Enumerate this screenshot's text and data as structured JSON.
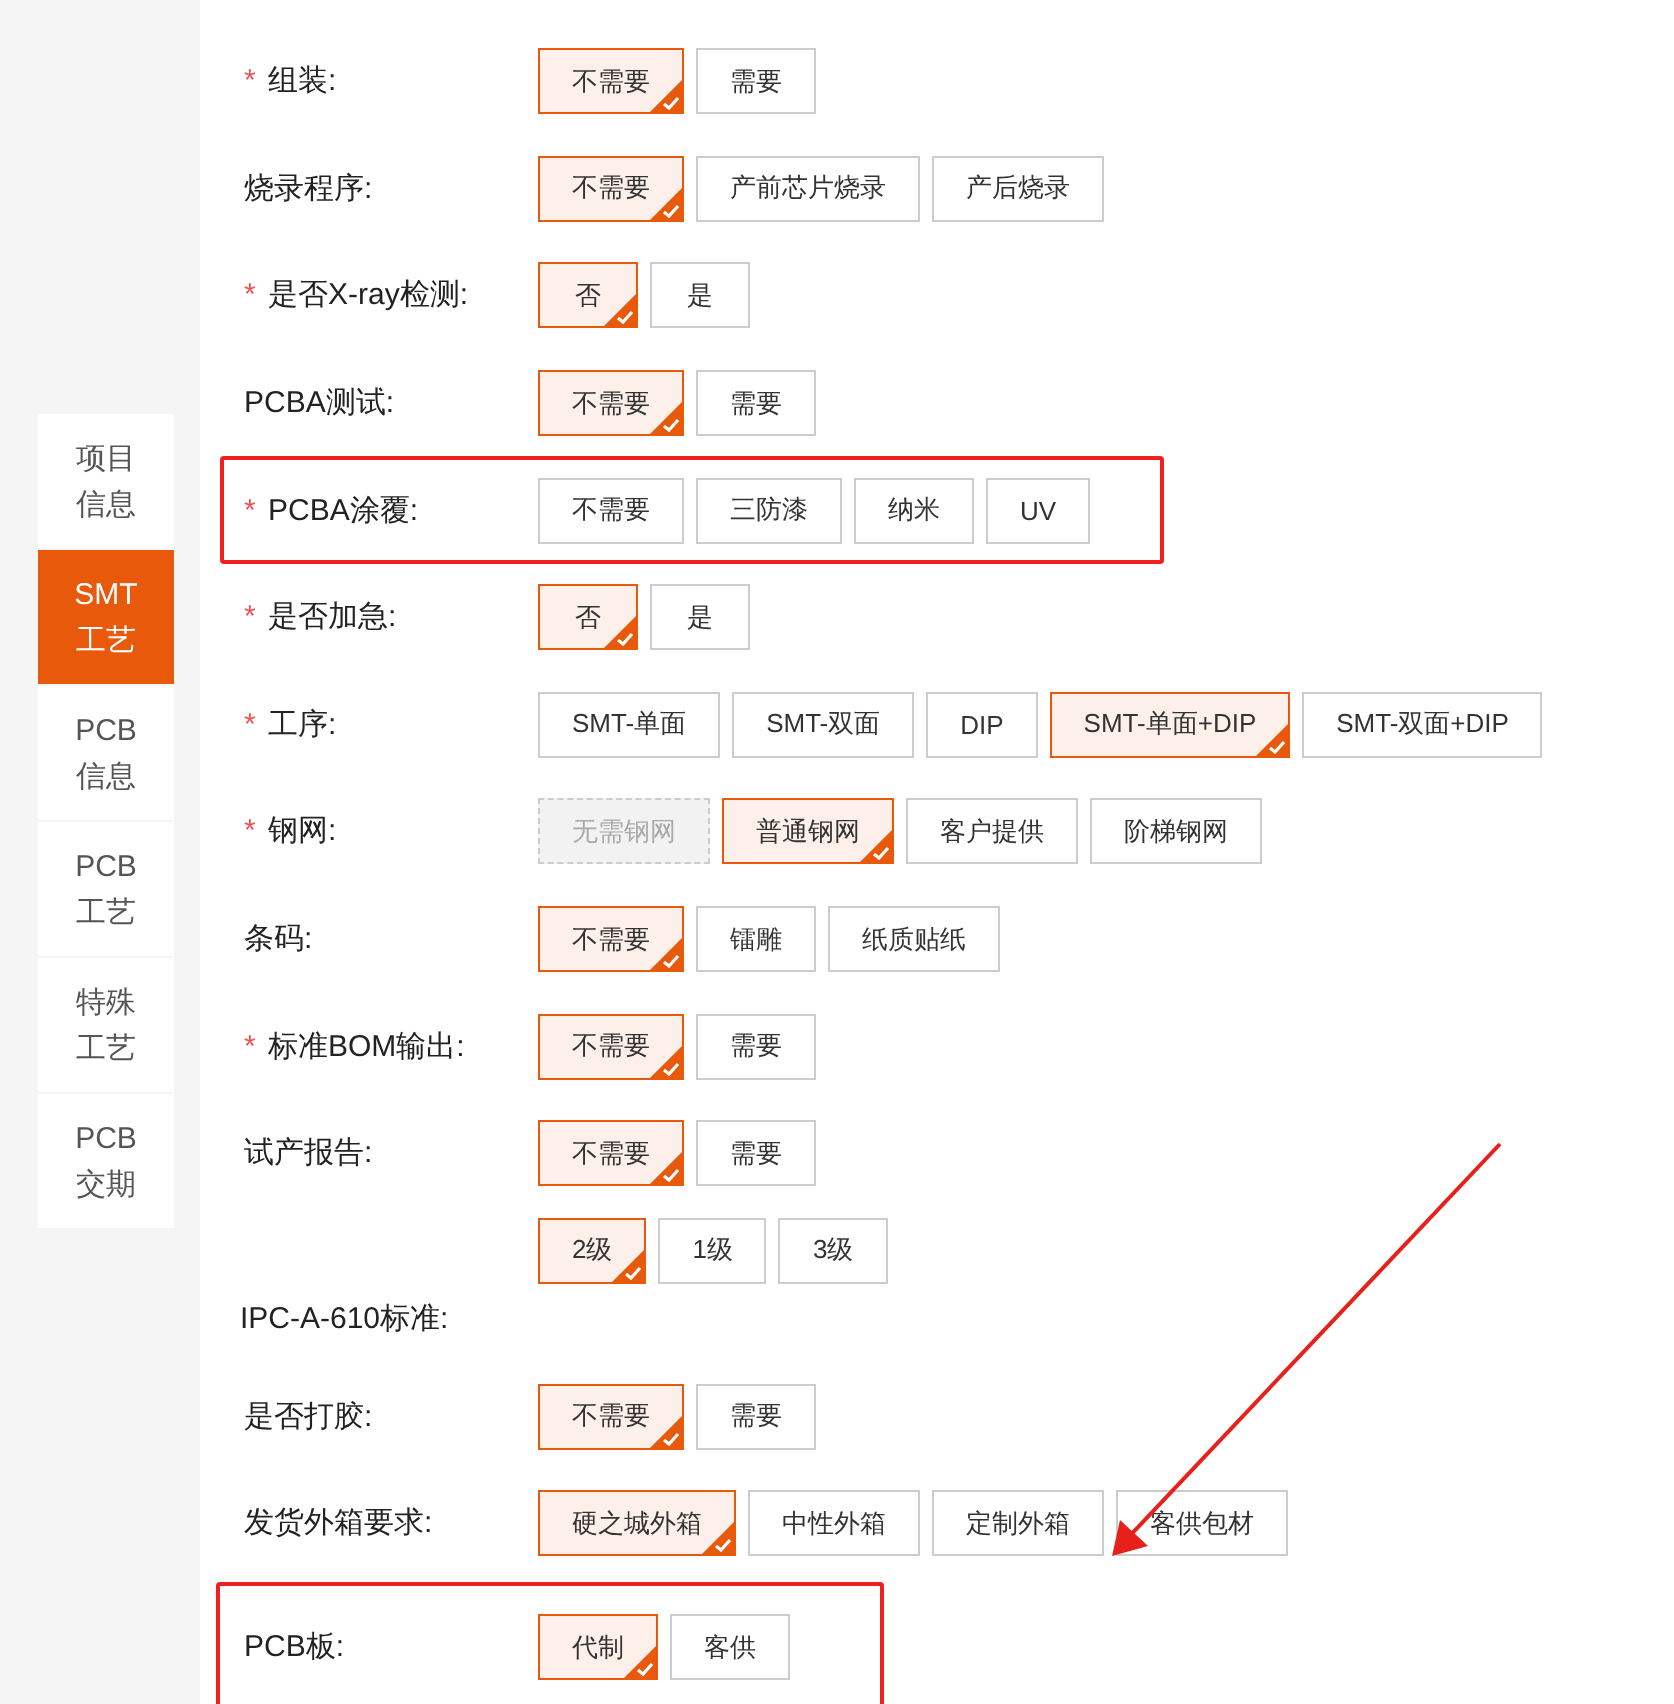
{
  "sidebar": {
    "items": [
      {
        "lines": [
          "项目",
          "信息"
        ],
        "selected": false
      },
      {
        "lines": [
          "SMT",
          "工艺"
        ],
        "selected": true
      },
      {
        "lines": [
          "PCB",
          "信息"
        ],
        "selected": false
      },
      {
        "lines": [
          "PCB",
          "工艺"
        ],
        "selected": false
      },
      {
        "lines": [
          "特殊",
          "工艺"
        ],
        "selected": false
      },
      {
        "lines": [
          "PCB",
          "交期"
        ],
        "selected": false
      }
    ]
  },
  "form": {
    "rows": [
      {
        "kind": "inline",
        "label": "组装:",
        "required_mark": "*",
        "highlighted": false,
        "options": [
          {
            "label": "不需要",
            "selected": true,
            "disabled": false
          },
          {
            "label": "需要",
            "selected": false,
            "disabled": false
          }
        ]
      },
      {
        "kind": "inline",
        "label": "烧录程序:",
        "highlighted": false,
        "options": [
          {
            "label": "不需要",
            "selected": true,
            "disabled": false
          },
          {
            "label": "产前芯片烧录",
            "selected": false,
            "disabled": false
          },
          {
            "label": "产后烧录",
            "selected": false,
            "disabled": false
          }
        ]
      },
      {
        "kind": "inline",
        "label": "是否X-ray检测:",
        "required_mark": "*",
        "highlighted": false,
        "options": [
          {
            "label": "否",
            "selected": true,
            "disabled": false
          },
          {
            "label": "是",
            "selected": false,
            "disabled": false
          }
        ]
      },
      {
        "kind": "inline",
        "label": "PCBA测试:",
        "highlighted": false,
        "options": [
          {
            "label": "不需要",
            "selected": true,
            "disabled": false
          },
          {
            "label": "需要",
            "selected": false,
            "disabled": false
          }
        ]
      },
      {
        "kind": "inline",
        "label": "PCBA涂覆:",
        "required_mark": "*",
        "highlighted": true,
        "options": [
          {
            "label": "不需要",
            "selected": false,
            "disabled": false
          },
          {
            "label": "三防漆",
            "selected": false,
            "disabled": false
          },
          {
            "label": "纳米",
            "selected": false,
            "disabled": false
          },
          {
            "label": "UV",
            "selected": false,
            "disabled": false
          }
        ]
      },
      {
        "kind": "inline",
        "label": "是否加急:",
        "required_mark": "*",
        "highlighted": false,
        "options": [
          {
            "label": "否",
            "selected": true,
            "disabled": false
          },
          {
            "label": "是",
            "selected": false,
            "disabled": false
          }
        ]
      },
      {
        "kind": "inline",
        "label": "工序:",
        "required_mark": "*",
        "highlighted": false,
        "options": [
          {
            "label": "SMT-单面",
            "selected": false,
            "disabled": false
          },
          {
            "label": "SMT-双面",
            "selected": false,
            "disabled": false
          },
          {
            "label": "DIP",
            "selected": false,
            "disabled": false
          },
          {
            "label": "SMT-单面+DIP",
            "selected": true,
            "disabled": false
          },
          {
            "label": "SMT-双面+DIP",
            "selected": false,
            "disabled": false
          }
        ]
      },
      {
        "kind": "inline",
        "label": "钢网:",
        "required_mark": "*",
        "highlighted": false,
        "options": [
          {
            "label": "无需钢网",
            "selected": false,
            "disabled": true
          },
          {
            "label": "普通钢网",
            "selected": true,
            "disabled": false
          },
          {
            "label": "客户提供",
            "selected": false,
            "disabled": false
          },
          {
            "label": "阶梯钢网",
            "selected": false,
            "disabled": false
          }
        ]
      },
      {
        "kind": "inline",
        "label": "条码:",
        "highlighted": false,
        "options": [
          {
            "label": "不需要",
            "selected": true,
            "disabled": false
          },
          {
            "label": "镭雕",
            "selected": false,
            "disabled": false
          },
          {
            "label": "纸质贴纸",
            "selected": false,
            "disabled": false
          }
        ]
      },
      {
        "kind": "inline",
        "label": "标准BOM输出:",
        "required_mark": "*",
        "highlighted": false,
        "options": [
          {
            "label": "不需要",
            "selected": true,
            "disabled": false
          },
          {
            "label": "需要",
            "selected": false,
            "disabled": false
          }
        ]
      },
      {
        "kind": "inline",
        "label": "试产报告:",
        "highlighted": false,
        "options": [
          {
            "label": "不需要",
            "selected": true,
            "disabled": false
          },
          {
            "label": "需要",
            "selected": false,
            "disabled": false
          }
        ]
      },
      {
        "kind": "label-below",
        "label": "IPC-A-610标准:",
        "highlighted": false,
        "options": [
          {
            "label": "2级",
            "selected": true,
            "disabled": false
          },
          {
            "label": "1级",
            "selected": false,
            "disabled": false
          },
          {
            "label": "3级",
            "selected": false,
            "disabled": false
          }
        ]
      },
      {
        "kind": "inline",
        "label": "是否打胶:",
        "highlighted": false,
        "options": [
          {
            "label": "不需要",
            "selected": true,
            "disabled": false
          },
          {
            "label": "需要",
            "selected": false,
            "disabled": false
          }
        ]
      },
      {
        "kind": "inline",
        "label": "发货外箱要求:",
        "highlighted": false,
        "options": [
          {
            "label": "硬之城外箱",
            "selected": true,
            "disabled": false
          },
          {
            "label": "中性外箱",
            "selected": false,
            "disabled": false
          },
          {
            "label": "定制外箱",
            "selected": false,
            "disabled": false
          },
          {
            "label": "客供包材",
            "selected": false,
            "disabled": false
          }
        ]
      },
      {
        "kind": "inline",
        "label": "PCB板:",
        "highlighted": true,
        "options": [
          {
            "label": "代制",
            "selected": true,
            "disabled": false
          },
          {
            "label": "客供",
            "selected": false,
            "disabled": false
          }
        ]
      }
    ]
  }
}
